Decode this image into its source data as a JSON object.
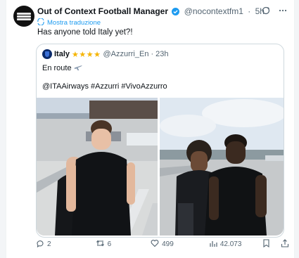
{
  "tweet": {
    "author_name": "Out of Context Football Manager",
    "handle": "@nocontextfm1",
    "time": "5h",
    "translate_label": "Mostra traduzione",
    "text": "Has anyone told Italy yet?!"
  },
  "quoted": {
    "author_name": "Italy",
    "stars": "★★★★",
    "handle": "@Azzurri_En",
    "time": "23h",
    "line1": "En route",
    "line2": "@ITAAirways #Azzurri #VivoAzzurro"
  },
  "actions": {
    "replies": "2",
    "retweets": "6",
    "likes": "499",
    "views": "42.073"
  },
  "colors": {
    "accent": "#1d9bf0",
    "muted": "#536471",
    "stars": "#f5b400"
  }
}
